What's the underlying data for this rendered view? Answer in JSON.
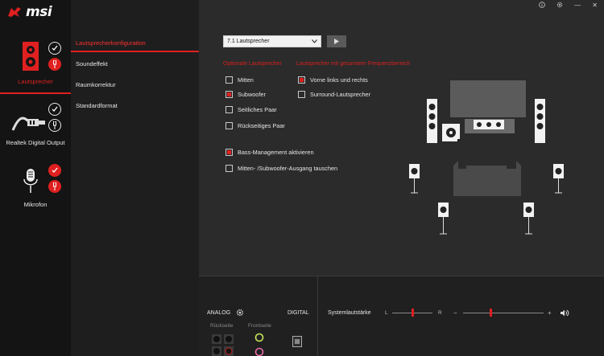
{
  "app": {
    "logo_text": "msi"
  },
  "devices": [
    {
      "label": "Lautsprecher",
      "active": true
    },
    {
      "label": "Realtek Digital Output",
      "active": false
    },
    {
      "label": "Mikrofon",
      "active": false
    }
  ],
  "menu": {
    "items": [
      "Lautsprecherkonfiguration",
      "Soundeffekt",
      "Raumkorrektur",
      "Standardformat"
    ],
    "active_index": 0
  },
  "window": {
    "info_icon": "info-icon",
    "settings_icon": "gear-icon",
    "minimize": "—",
    "close": "✕"
  },
  "config": {
    "speaker_select": "7.1 Lautsprecher",
    "optional_header": "Optionale Lautsprecher",
    "fullrange_header": "Lautsprecher mit gesamtem Frequenzbereich",
    "optional": [
      {
        "label": "Mitten",
        "checked": false
      },
      {
        "label": "Subwoofer",
        "checked": true
      },
      {
        "label": "Seitliches Paar",
        "checked": false
      },
      {
        "label": "Rückseitiges Paar",
        "checked": false
      }
    ],
    "fullrange": [
      {
        "label": "Vorne links und rechts",
        "checked": true
      },
      {
        "label": "Surround-Lautsprecher",
        "checked": false
      }
    ],
    "bass_management": {
      "label": "Bass-Management aktivieren",
      "checked": true
    },
    "swap": {
      "label": "Mitten- /Subwoofer-Ausgang tauschen",
      "checked": false
    }
  },
  "bottom": {
    "analog": "ANALOG",
    "digital": "DIGITAL",
    "rear": "Rückseite",
    "front": "Frontseite",
    "volume_label": "Systemlautstärke",
    "balance_left": "L",
    "balance_right": "R",
    "vol_minus": "−",
    "vol_plus": "+",
    "balance_value": 0.5,
    "volume_value": 0.34
  },
  "colors": {
    "accent": "#e02020",
    "bg": "#2b2b2b",
    "sidebar": "#141414"
  }
}
